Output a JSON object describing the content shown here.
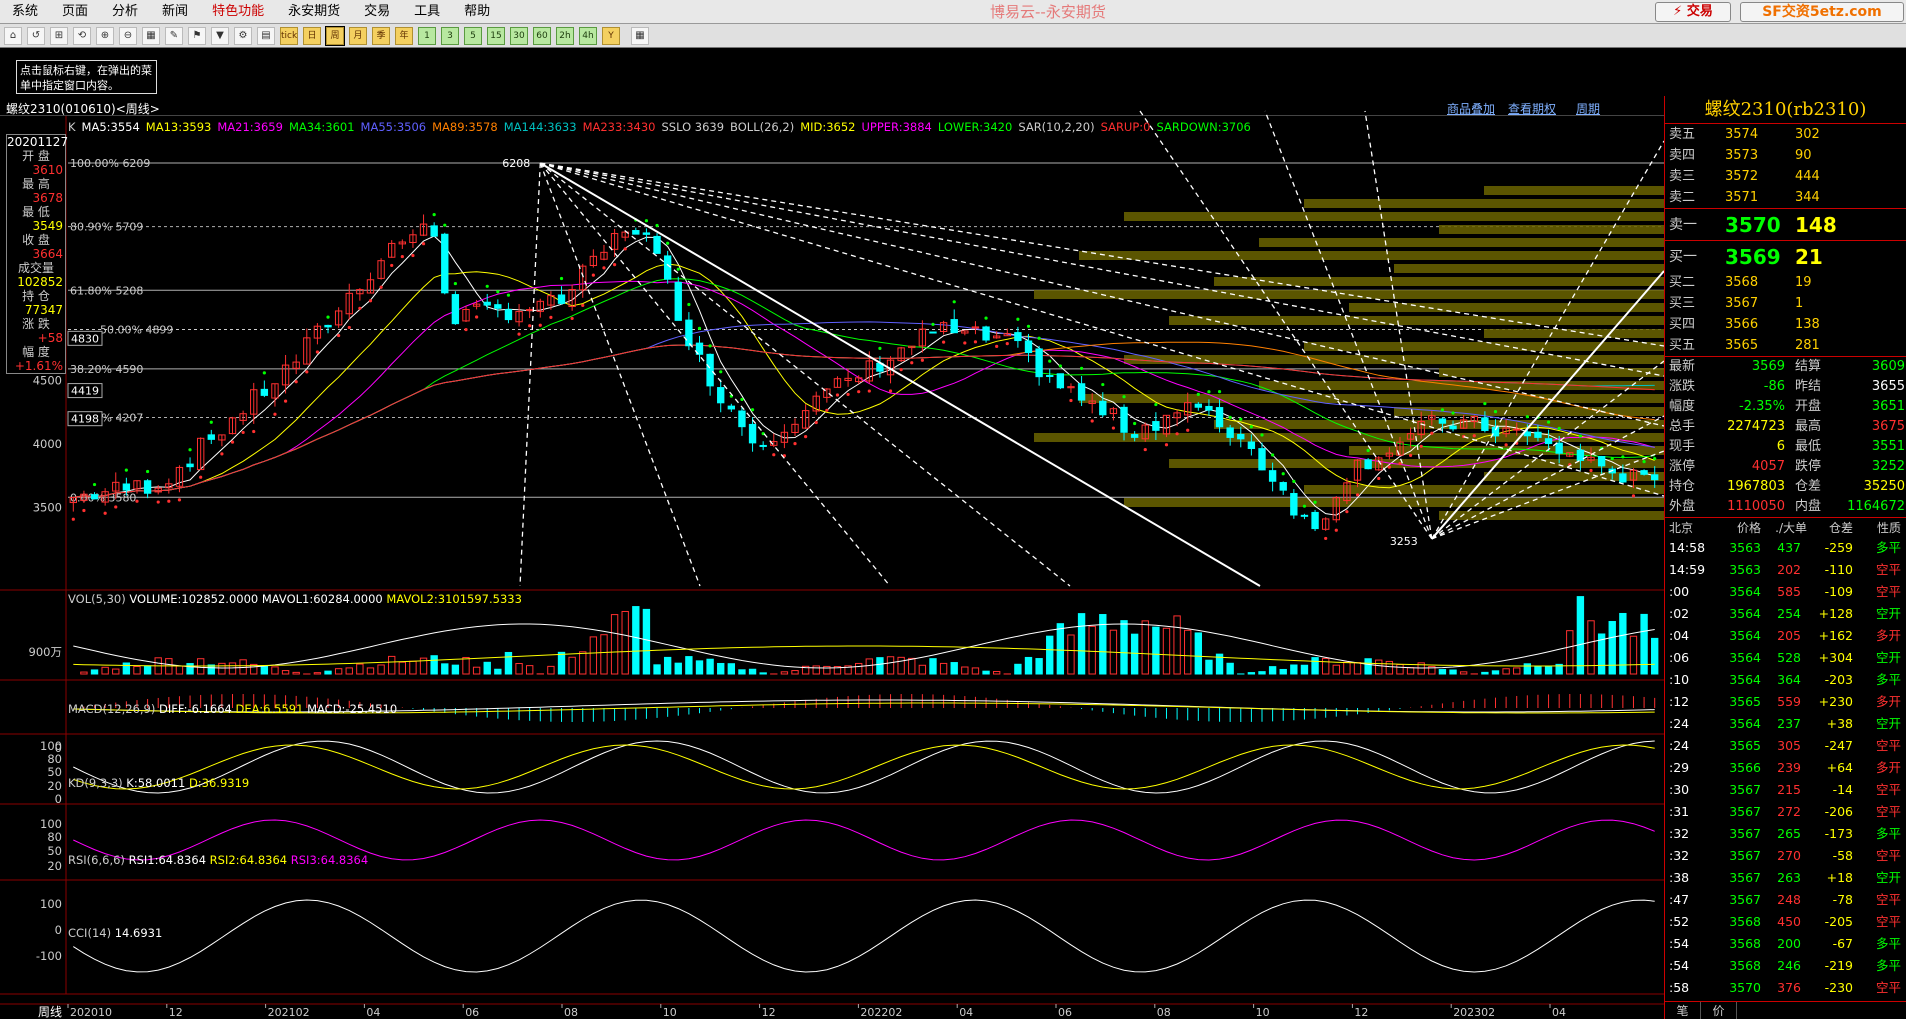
{
  "menu": {
    "items": [
      "系统",
      "页面",
      "分析",
      "新闻",
      "特色功能",
      "永安期货",
      "交易",
      "工具",
      "帮助"
    ],
    "highlight_index": 4,
    "app_title": "博易云--永安期货",
    "trade_button": "⚡ 交易",
    "site_badge": "SF交资5etz.com"
  },
  "toolbar": {
    "periods": [
      "tick",
      "日",
      "周",
      "月",
      "季",
      "年",
      "1",
      "3",
      "5",
      "15",
      "30",
      "60",
      "2h",
      "4h",
      "Y"
    ],
    "selected_period": "周"
  },
  "hint": "点击鼠标右键，在弹出的菜单中指定窗口内容。",
  "chart": {
    "instrument_label": "螺纹2310(010610)<周线>",
    "links": [
      "商品叠加",
      "查看期权",
      "周期"
    ],
    "main_indicators": [
      {
        "text": "K",
        "color": "#cccccc"
      },
      {
        "text": "MA5:3554",
        "color": "#ffffff"
      },
      {
        "text": "MA13:3593",
        "color": "#ffff00"
      },
      {
        "text": "MA21:3659",
        "color": "#ff00ff"
      },
      {
        "text": "MA34:3601",
        "color": "#00ff00"
      },
      {
        "text": "MA55:3506",
        "color": "#6060ff"
      },
      {
        "text": "MA89:3578",
        "color": "#ff8000"
      },
      {
        "text": "MA144:3633",
        "color": "#00c0c0"
      },
      {
        "text": "MA233:3430",
        "color": "#ff3030"
      },
      {
        "text": "SSLO 3639",
        "color": "#cccccc"
      },
      {
        "text": "BOLL(26,2)",
        "color": "#cccccc"
      },
      {
        "text": "MID:3652",
        "color": "#ffff00"
      },
      {
        "text": "UPPER:3884",
        "color": "#ff00ff"
      },
      {
        "text": "LOWER:3420",
        "color": "#00ff00"
      },
      {
        "text": "SAR(10,2,20)",
        "color": "#cccccc"
      },
      {
        "text": "SARUP:0",
        "color": "#ff3030"
      },
      {
        "text": "SARDOWN:3706",
        "color": "#00ff00"
      }
    ],
    "info_box": {
      "date": "20201127",
      "open_label": "开 盘",
      "open": "3610",
      "high_label": "最 高",
      "high": "3678",
      "low_label": "最 低",
      "low": "3549",
      "close_label": "收 盘",
      "close": "3664",
      "volume_label": "成交量",
      "volume": "102852",
      "oi_label": "持 仓",
      "oi": "77347",
      "change_label": "涨 跌",
      "change": "+58",
      "pct_label": "幅 度",
      "pct": "+1.61%"
    },
    "fib_labels": [
      "100.00% 6209",
      "80.90% 5709",
      "61.80% 5208",
      "38.20% 4590",
      "23.60% 4207",
      "0.00% 3580"
    ],
    "fib_extra": [
      "50.00% 4899"
    ],
    "price_axis": [
      "4500",
      "4000",
      "3500"
    ],
    "price_boxes": [
      "4830",
      "4419",
      "4198"
    ],
    "peak_label": "6208",
    "trough_label": "3253",
    "volume_panel": {
      "label_prefix": "VOL(5,30)",
      "volume": "VOLUME:102852.0000",
      "mavol1": "MAVOL1:60284.0000",
      "mavol2": "MAVOL2:3101597.5333",
      "axis": "900万"
    },
    "macd_panel": {
      "label": "MACD(12,26,9)",
      "diff": "DIFF:-6.1664",
      "dea": "DEA:6.5591",
      "macd": "MACD:-25.4510",
      "axis": "0"
    },
    "kd_panel": {
      "label": "KD(9,3,3)",
      "k": "K:58.0011",
      "d": "D:36.9319",
      "axis": [
        "100",
        "80",
        "50",
        "20",
        "0"
      ]
    },
    "rsi_panel": {
      "label": "RSI(6,6,6)",
      "rsi1": "RSI1:64.8364",
      "rsi2": "RSI2:64.8364",
      "rsi3": "RSI3:64.8364",
      "axis": [
        "100",
        "80",
        "50",
        "20"
      ]
    },
    "cci_panel": {
      "label": "CCI(14)",
      "value": "14.6931",
      "axis": [
        "100",
        "0",
        "-100"
      ]
    },
    "x_axis": {
      "period_label": "周线",
      "ticks": [
        "202010",
        "12",
        "202102",
        "04",
        "06",
        "08",
        "10",
        "12",
        "202202",
        "04",
        "06",
        "08",
        "10",
        "12",
        "202302",
        "04"
      ]
    }
  },
  "quote": {
    "title": "螺纹2310(rb2310)",
    "asks": [
      {
        "label": "卖五",
        "price": "3574",
        "vol": "302"
      },
      {
        "label": "卖四",
        "price": "3573",
        "vol": "90"
      },
      {
        "label": "卖三",
        "price": "3572",
        "vol": "444"
      },
      {
        "label": "卖二",
        "price": "3571",
        "vol": "344"
      }
    ],
    "ask1": {
      "label": "卖一",
      "price": "3570",
      "vol": "148"
    },
    "bid1": {
      "label": "买一",
      "price": "3569",
      "vol": "21"
    },
    "bids": [
      {
        "label": "买二",
        "price": "3568",
        "vol": "19"
      },
      {
        "label": "买三",
        "price": "3567",
        "vol": "1"
      },
      {
        "label": "买四",
        "price": "3566",
        "vol": "138"
      },
      {
        "label": "买五",
        "price": "3565",
        "vol": "281"
      }
    ],
    "stats": [
      {
        "k1": "最新",
        "v1": "3569",
        "c1": "#00ff00",
        "k2": "结算",
        "v2": "3609",
        "c2": "#00ff00"
      },
      {
        "k1": "涨跌",
        "v1": "-86",
        "c1": "#00ff00",
        "k2": "昨结",
        "v2": "3655",
        "c2": "#ffffff"
      },
      {
        "k1": "幅度",
        "v1": "-2.35%",
        "c1": "#00ff00",
        "k2": "开盘",
        "v2": "3651",
        "c2": "#00ff00"
      },
      {
        "k1": "总手",
        "v1": "2274723",
        "c1": "#ffff00",
        "k2": "最高",
        "v2": "3675",
        "c2": "#ff3030"
      },
      {
        "k1": "现手",
        "v1": "6",
        "c1": "#ffff00",
        "k2": "最低",
        "v2": "3551",
        "c2": "#00ff00"
      },
      {
        "k1": "涨停",
        "v1": "4057",
        "c1": "#ff3030",
        "k2": "跌停",
        "v2": "3252",
        "c2": "#00ff00"
      },
      {
        "k1": "持仓",
        "v1": "1967803",
        "c1": "#ffff00",
        "k2": "仓差",
        "v2": "35250",
        "c2": "#ffff00"
      },
      {
        "k1": "外盘",
        "v1": "1110050",
        "c1": "#ff3030",
        "k2": "内盘",
        "v2": "1164672",
        "c2": "#00ff00"
      }
    ],
    "ticks_header": [
      "北京",
      "价格",
      "./大单",
      "仓差",
      "性质"
    ],
    "ticks": [
      {
        "time": "14:58",
        "price": "3563",
        "vol": "437",
        "oi": "-259",
        "nature": "多平",
        "nc": "#00ff00"
      },
      {
        "time": "14:59",
        "price": "3563",
        "vol": "202",
        "oi": "-110",
        "nature": "空平",
        "nc": "#ff3030"
      },
      {
        "time": ":00",
        "price": "3564",
        "vol": "585",
        "oi": "-109",
        "nature": "空平",
        "nc": "#ff3030"
      },
      {
        "time": ":02",
        "price": "3564",
        "vol": "254",
        "oi": "+128",
        "nature": "空开",
        "nc": "#00ff00"
      },
      {
        "time": ":04",
        "price": "3564",
        "vol": "205",
        "oi": "+162",
        "nature": "多开",
        "nc": "#ff3030"
      },
      {
        "time": ":06",
        "price": "3564",
        "vol": "528",
        "oi": "+304",
        "nature": "空开",
        "nc": "#00ff00"
      },
      {
        "time": ":10",
        "price": "3564",
        "vol": "364",
        "oi": "-203",
        "nature": "多平",
        "nc": "#00ff00"
      },
      {
        "time": ":12",
        "price": "3565",
        "vol": "559",
        "oi": "+230",
        "nature": "多开",
        "nc": "#ff3030"
      },
      {
        "time": ":24",
        "price": "3564",
        "vol": "237",
        "oi": "+38",
        "nature": "空开",
        "nc": "#00ff00"
      },
      {
        "time": ":24",
        "price": "3565",
        "vol": "305",
        "oi": "-247",
        "nature": "空平",
        "nc": "#ff3030"
      },
      {
        "time": ":29",
        "price": "3566",
        "vol": "239",
        "oi": "+64",
        "nature": "多开",
        "nc": "#ff3030"
      },
      {
        "time": ":30",
        "price": "3567",
        "vol": "215",
        "oi": "-14",
        "nature": "空平",
        "nc": "#ff3030"
      },
      {
        "time": ":31",
        "price": "3567",
        "vol": "272",
        "oi": "-206",
        "nature": "空平",
        "nc": "#ff3030"
      },
      {
        "time": ":32",
        "price": "3567",
        "vol": "265",
        "oi": "-173",
        "nature": "多平",
        "nc": "#00ff00"
      },
      {
        "time": ":32",
        "price": "3567",
        "vol": "270",
        "oi": "-58",
        "nature": "空平",
        "nc": "#ff3030"
      },
      {
        "time": ":38",
        "price": "3567",
        "vol": "263",
        "oi": "+18",
        "nature": "空开",
        "nc": "#00ff00"
      },
      {
        "time": ":47",
        "price": "3567",
        "vol": "248",
        "oi": "-78",
        "nature": "空平",
        "nc": "#ff3030"
      },
      {
        "time": ":52",
        "price": "3568",
        "vol": "450",
        "oi": "-205",
        "nature": "空平",
        "nc": "#ff3030"
      },
      {
        "time": ":54",
        "price": "3568",
        "vol": "200",
        "oi": "-67",
        "nature": "多平",
        "nc": "#00ff00"
      },
      {
        "time": ":54",
        "price": "3568",
        "vol": "246",
        "oi": "-219",
        "nature": "多平",
        "nc": "#00ff00"
      },
      {
        "time": ":58",
        "price": "3570",
        "vol": "376",
        "oi": "-230",
        "nature": "空平",
        "nc": "#ff3030"
      }
    ],
    "bottom_tabs": [
      "笔",
      "价"
    ]
  }
}
